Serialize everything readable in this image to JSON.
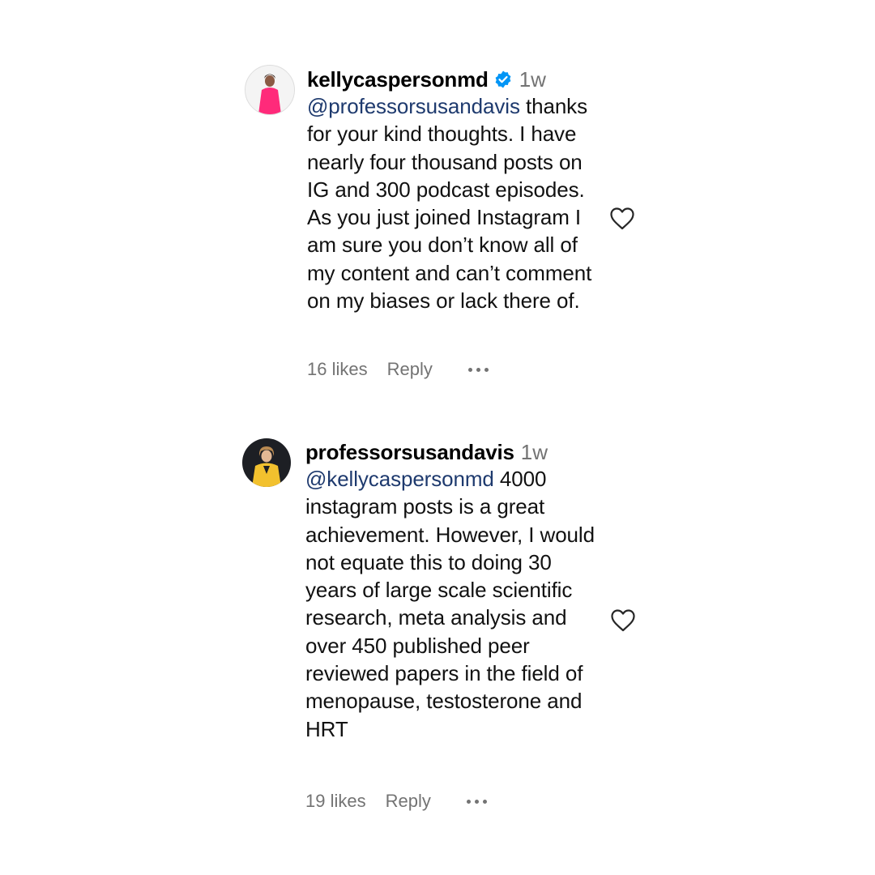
{
  "comments": [
    {
      "username": "kellycaspersonmd",
      "verified": true,
      "time": "1w",
      "mention": "@professorsusandavis",
      "text": " thanks for your kind thoughts. I have nearly four thousand posts on IG and 300 podcast episodes. As you just joined Instagram I am sure you don’t know all of my content and can’t comment on my biases or lack there of.",
      "likes": "16 likes",
      "reply_label": "Reply",
      "avatar_icon": "avatar-woman-pink-dress"
    },
    {
      "username": "professorsusandavis",
      "verified": false,
      "time": "1w",
      "mention": "@kellycaspersonmd",
      "text": " 4000 instagram posts is a great achievement. However, I would not equate this to doing 30 years of large scale scientific research, meta analysis and over 450 published peer reviewed papers in the field of menopause, testosterone and HRT",
      "likes": "19 likes",
      "reply_label": "Reply",
      "avatar_icon": "avatar-woman-yellow-jacket"
    }
  ],
  "colors": {
    "verified_badge": "#0095f6",
    "mention": "#1e3a6e",
    "muted": "#737373"
  },
  "icons": {
    "like": "heart-outline-icon",
    "more": "more-horizontal-icon",
    "verified": "verified-badge-icon"
  }
}
